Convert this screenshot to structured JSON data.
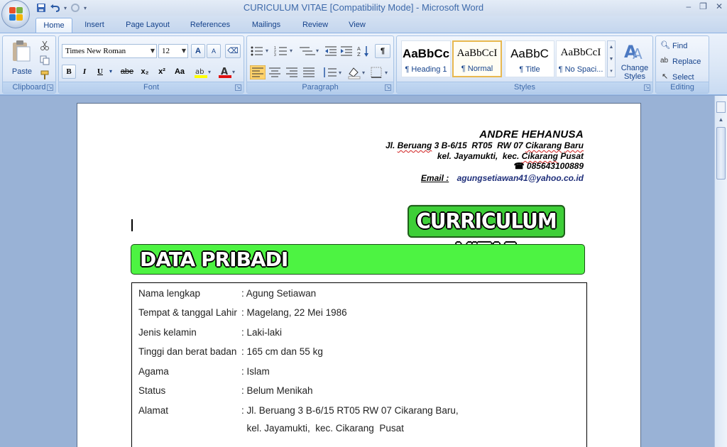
{
  "window": {
    "title": "CURICULUM VITAE [Compatibility Mode] - Microsoft Word",
    "controls": [
      "–",
      "❐",
      "✕"
    ]
  },
  "tabs": [
    {
      "label": "Home",
      "active": true
    },
    {
      "label": "Insert"
    },
    {
      "label": "Page Layout"
    },
    {
      "label": "References"
    },
    {
      "label": "Mailings"
    },
    {
      "label": "Review"
    },
    {
      "label": "View"
    }
  ],
  "ribbon": {
    "clipboard": {
      "label": "Clipboard",
      "paste": "Paste"
    },
    "font": {
      "label": "Font",
      "family": "Times New Roman",
      "size": "12",
      "bold": "B",
      "italic": "I",
      "underline": "U",
      "strike": "abe",
      "subscript": "x₂",
      "superscript": "x²",
      "change_case": "Aa",
      "grow": "A",
      "shrink": "A"
    },
    "paragraph": {
      "label": "Paragraph",
      "pilcrow": "¶"
    },
    "styles": {
      "label": "Styles",
      "items": [
        {
          "sample": "AaBbCc",
          "name": "¶ Heading 1"
        },
        {
          "sample": "AaBbCcI",
          "name": "¶ Normal",
          "selected": true
        },
        {
          "sample": "AaBbC",
          "name": "¶ Title"
        },
        {
          "sample": "AaBbCcI",
          "name": "¶ No Spaci..."
        }
      ],
      "change_styles": "Change Styles"
    },
    "editing": {
      "label": "Editing",
      "find": "Find",
      "replace": "Replace",
      "select": "Select"
    }
  },
  "document": {
    "header": {
      "name": "ANDRE HEHANUSA",
      "address_line1_prefix": "Jl.",
      "address_line1_word1": "Beruang",
      "address_line1_mid": " 3 B-6/15  RT05  RW 07 ",
      "address_line1_word2": "Cikarang",
      "address_line1_word3": "Baru",
      "address_line2_prefix": "kel. Jayamukti,  kec. ",
      "address_line2_word": "Cikarang",
      "address_line2_suffix": " Pusat",
      "phone": "085643100889",
      "email_label": "Email :",
      "email": "agungsetiawan41@yahoo.co.id"
    },
    "cv_title": "CURRICULUM VITAE",
    "section_title": "DATA PRIBADI",
    "personal_data": [
      {
        "label": "Nama lengkap",
        "value": ": Agung Setiawan"
      },
      {
        "label": "Tempat & tanggal Lahir",
        "value": ": Magelang, 22 Mei 1986"
      },
      {
        "label": "Jenis kelamin",
        "value": ": Laki-laki"
      },
      {
        "label": "Tinggi dan  berat badan",
        "value": ": 165 cm dan 55 kg"
      },
      {
        "label": "Agama",
        "value": ": Islam"
      },
      {
        "label": "Status",
        "value": ": Belum Menikah"
      },
      {
        "label": "Alamat",
        "value": ": Jl. Beruang  3 B-6/15  RT05  RW 07 Cikarang  Baru,"
      },
      {
        "label": "",
        "value": "  kel. Jayamukti,  kec. Cikarang  Pusat"
      }
    ]
  }
}
